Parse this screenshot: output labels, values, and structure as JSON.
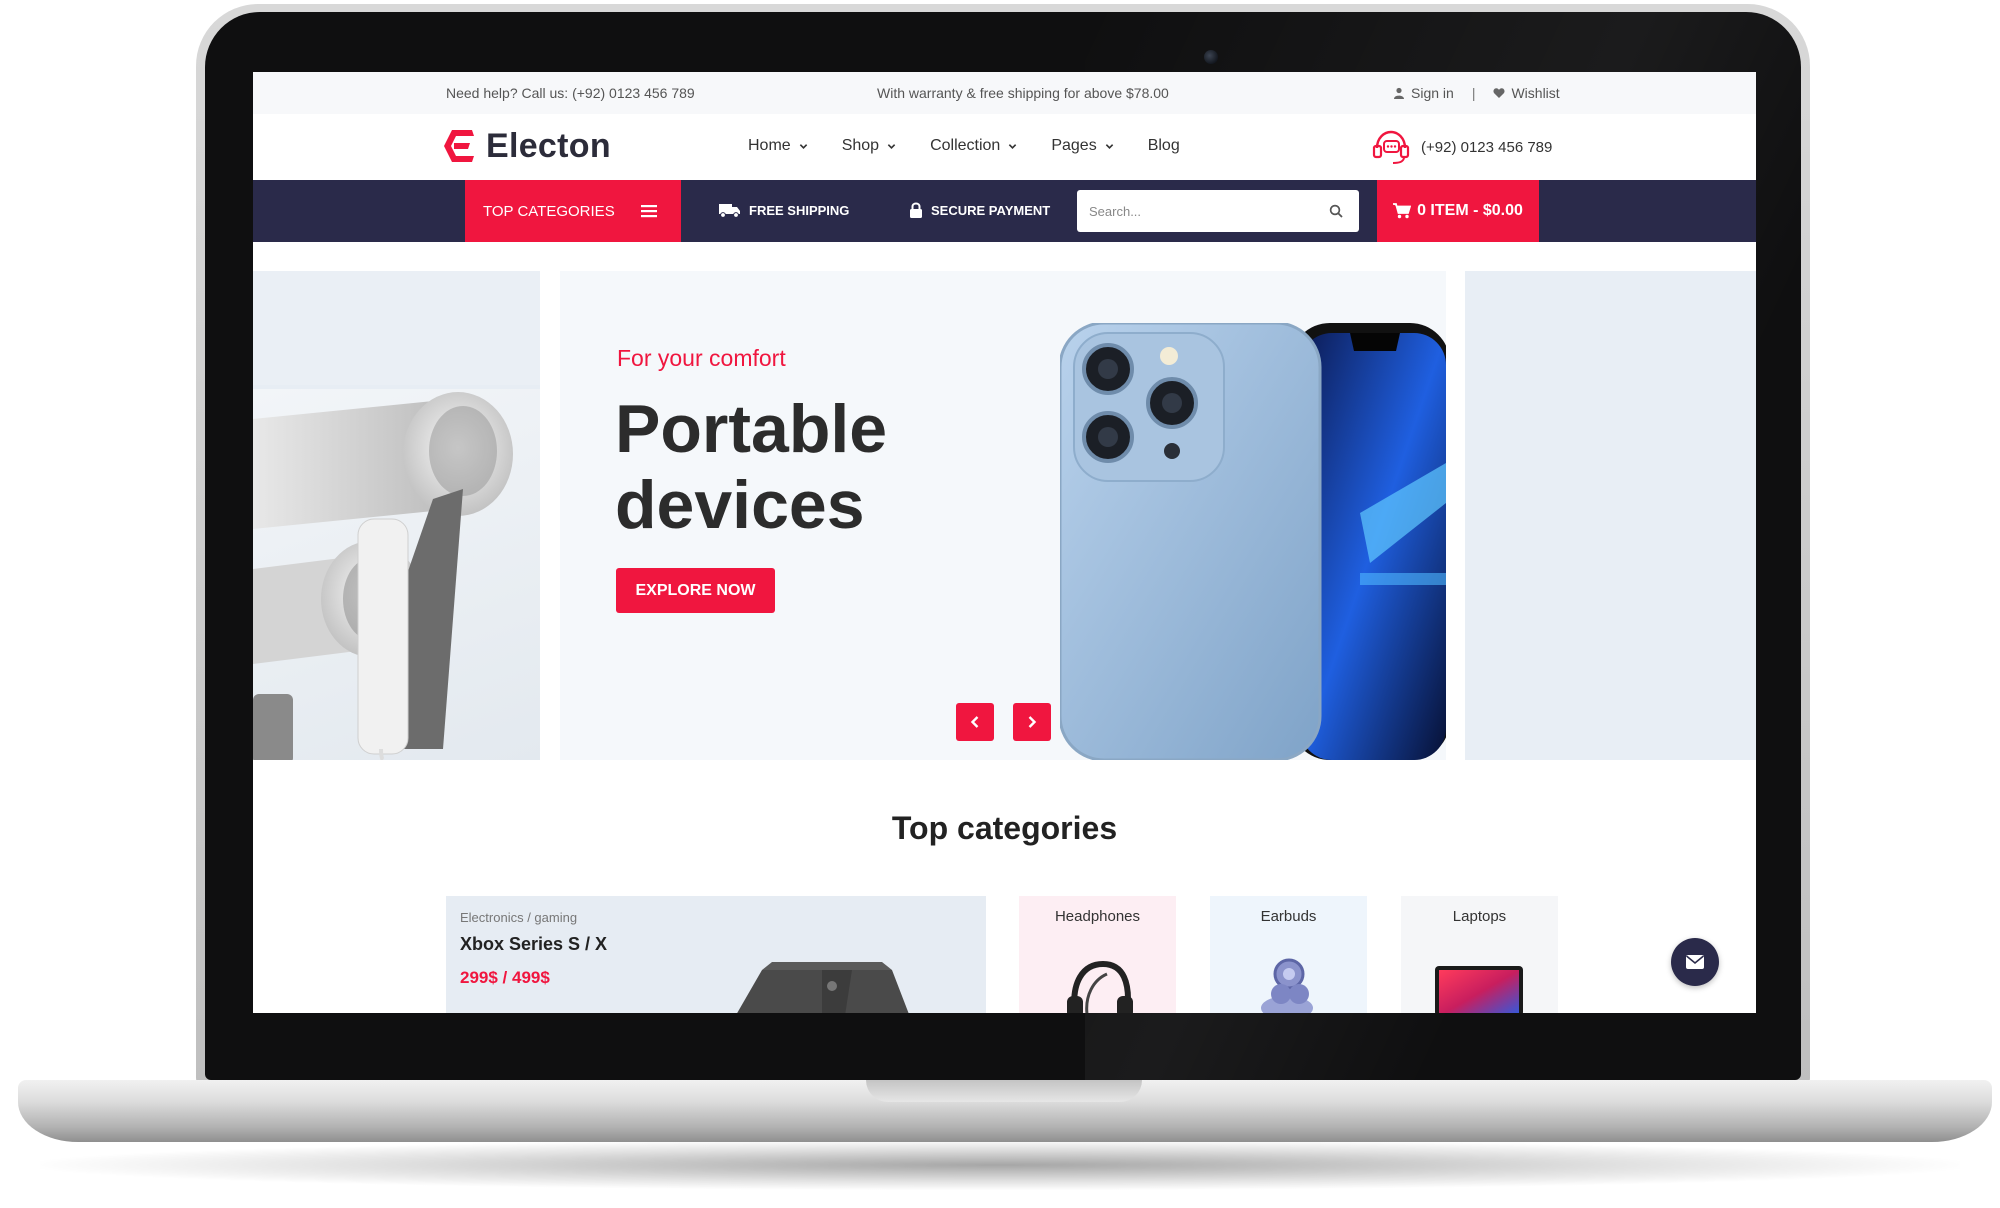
{
  "topbar": {
    "help_text": "Need help? Call us: (+92) 0123 456 789",
    "promo_text": "With warranty & free shipping for above $78.00",
    "signin_label": "Sign in",
    "separator": "|",
    "wishlist_label": "Wishlist"
  },
  "header": {
    "logo_text": "Electon",
    "nav": [
      {
        "label": "Home"
      },
      {
        "label": "Shop"
      },
      {
        "label": "Collection"
      },
      {
        "label": "Pages"
      },
      {
        "label": "Blog"
      }
    ],
    "support_phone": "(+92) 0123 456 789"
  },
  "catbar": {
    "top_categories_label": "TOP CATEGORIES",
    "free_shipping_label": "FREE SHIPPING",
    "secure_payment_label": "SECURE PAYMENT",
    "search_placeholder": "Search...",
    "cart_label": "0 ITEM - $0.00"
  },
  "hero": {
    "subtitle": "For your comfort",
    "title": "Portable devices",
    "cta_label": "EXPLORE NOW"
  },
  "categories": {
    "section_title": "Top categories",
    "featured": {
      "breadcrumb": "Electronics / gaming",
      "name": "Xbox Series S / X",
      "price": "299$ / 499$"
    },
    "items": [
      {
        "label": "Headphones"
      },
      {
        "label": "Earbuds"
      },
      {
        "label": "Laptops"
      }
    ]
  },
  "colors": {
    "accent": "#f0163f",
    "navy": "#2a2a4a"
  },
  "icons": [
    "user-icon",
    "heart-icon",
    "logo-e-icon",
    "chevron-down-icon",
    "headset-icon",
    "menu-icon",
    "truck-icon",
    "lock-icon",
    "search-icon",
    "cart-icon",
    "chevron-left-icon",
    "chevron-right-icon",
    "mail-icon"
  ]
}
